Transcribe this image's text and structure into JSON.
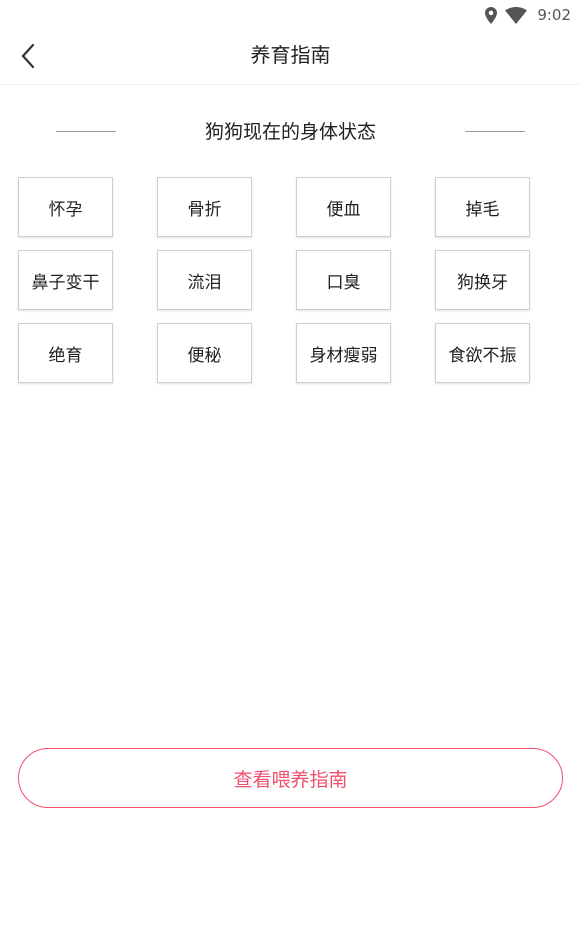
{
  "status_bar": {
    "time": "9:02"
  },
  "app_bar": {
    "title": "养育指南"
  },
  "section": {
    "heading": "狗狗现在的身体状态"
  },
  "tags": [
    {
      "label": "怀孕"
    },
    {
      "label": "骨折"
    },
    {
      "label": "便血"
    },
    {
      "label": "掉毛"
    },
    {
      "label": "鼻子变干"
    },
    {
      "label": "流泪"
    },
    {
      "label": "口臭"
    },
    {
      "label": "狗换牙"
    },
    {
      "label": "绝育"
    },
    {
      "label": "便秘"
    },
    {
      "label": "身材瘦弱"
    },
    {
      "label": "食欲不振"
    }
  ],
  "footer": {
    "button_label": "查看喂养指南"
  },
  "colors": {
    "accent": "#f0506e",
    "tag_border": "#cfcfcf",
    "divider": "#999999"
  }
}
